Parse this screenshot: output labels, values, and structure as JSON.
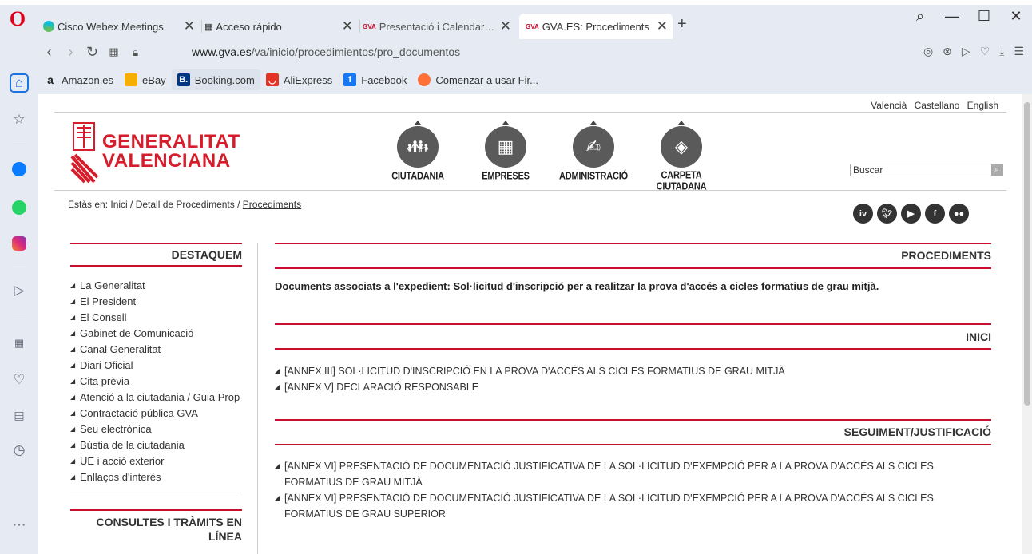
{
  "browser": {
    "tabs": [
      {
        "title": "Cisco Webex Meetings"
      },
      {
        "title": "Acceso rápido"
      },
      {
        "title": "Presentació i Calendari - G"
      },
      {
        "title": "GVA.ES: Procediments"
      }
    ],
    "address": {
      "host": "www.gva.es",
      "path": "/va/inicio/procedimientos/pro_documentos"
    },
    "bookmarks": [
      {
        "label": "Amazon.es",
        "color": "#222222"
      },
      {
        "label": "eBay",
        "color": "#e53238"
      },
      {
        "label": "Booking.com",
        "color": "#003580"
      },
      {
        "label": "AliExpress",
        "color": "#e43225"
      },
      {
        "label": "Facebook",
        "color": "#1877f2"
      },
      {
        "label": "Comenzar a usar Fir...",
        "color": "#ff7139"
      }
    ],
    "sidebar_icons": [
      "home-icon",
      "star-icon",
      "messenger-icon",
      "whatsapp-icon",
      "instagram-icon",
      "send-icon",
      "grid-icon",
      "heart-icon",
      "news-icon",
      "clock-icon",
      "more-icon"
    ]
  },
  "site": {
    "languages": [
      "Valencià",
      "Castellano",
      "English"
    ],
    "logo": {
      "line1": "GENERALITAT",
      "line2": "VALENCIANA"
    },
    "nav": [
      {
        "label": "CIUTADANIA"
      },
      {
        "label": "EMPRESES"
      },
      {
        "label": "ADMINISTRACIÓ"
      },
      {
        "label": "CARPETA CIUTADANA"
      }
    ],
    "search_placeholder": "Buscar",
    "breadcrumb": {
      "prefix": "Estàs en: Inici / Detall de Procediments / ",
      "current": "Procediments"
    },
    "social": [
      "iv",
      "tw",
      "yt",
      "f",
      "fl"
    ],
    "accent": "#c8102e"
  },
  "left": {
    "destaquem_title": "DESTAQUEM",
    "menu": [
      "La Generalitat",
      "El President",
      "El Consell",
      "Gabinet de Comunicació",
      "Canal Generalitat",
      "Diari Oficial",
      "Cita prèvia",
      "Atenció a la ciutadania / Guia Prop",
      "Contractació pública GVA",
      "Seu electrònica",
      "Bústia de la ciutadania",
      "UE i acció exterior",
      "Enllaços d'interés"
    ],
    "consultes_title": "CONSULTES I TRÀMITS EN LÍNEA"
  },
  "right": {
    "procediments_title": "PROCEDIMENTS",
    "description": "Documents associats a l'expedient: Sol·licitud d'inscripció per a realitzar la prova d'accés a cicles formatius de grau mitjà.",
    "inici_title": "INICI",
    "inici_docs": [
      "[ANNEX III] SOL·LICITUD D'INSCRIPCIÓ EN LA PROVA D'ACCÉS ALS CICLES FORMATIUS DE GRAU MITJÀ",
      "[ANNEX V] DECLARACIÓ RESPONSABLE"
    ],
    "seguiment_title": "SEGUIMENT/JUSTIFICACIÓ",
    "seguiment_docs": [
      "[ANNEX VI] PRESENTACIÓ DE DOCUMENTACIÓ JUSTIFICATIVA DE LA SOL·LICITUD D'EXEMPCIÓ PER A LA PROVA D'ACCÉS ALS CICLES FORMATIUS DE GRAU MITJÀ",
      "[ANNEX VI] PRESENTACIÓ DE DOCUMENTACIÓ JUSTIFICATIVA DE LA SOL·LICITUD D'EXEMPCIÓ PER A LA PROVA D'ACCÉS ALS CICLES FORMATIUS DE GRAU SUPERIOR"
    ]
  }
}
